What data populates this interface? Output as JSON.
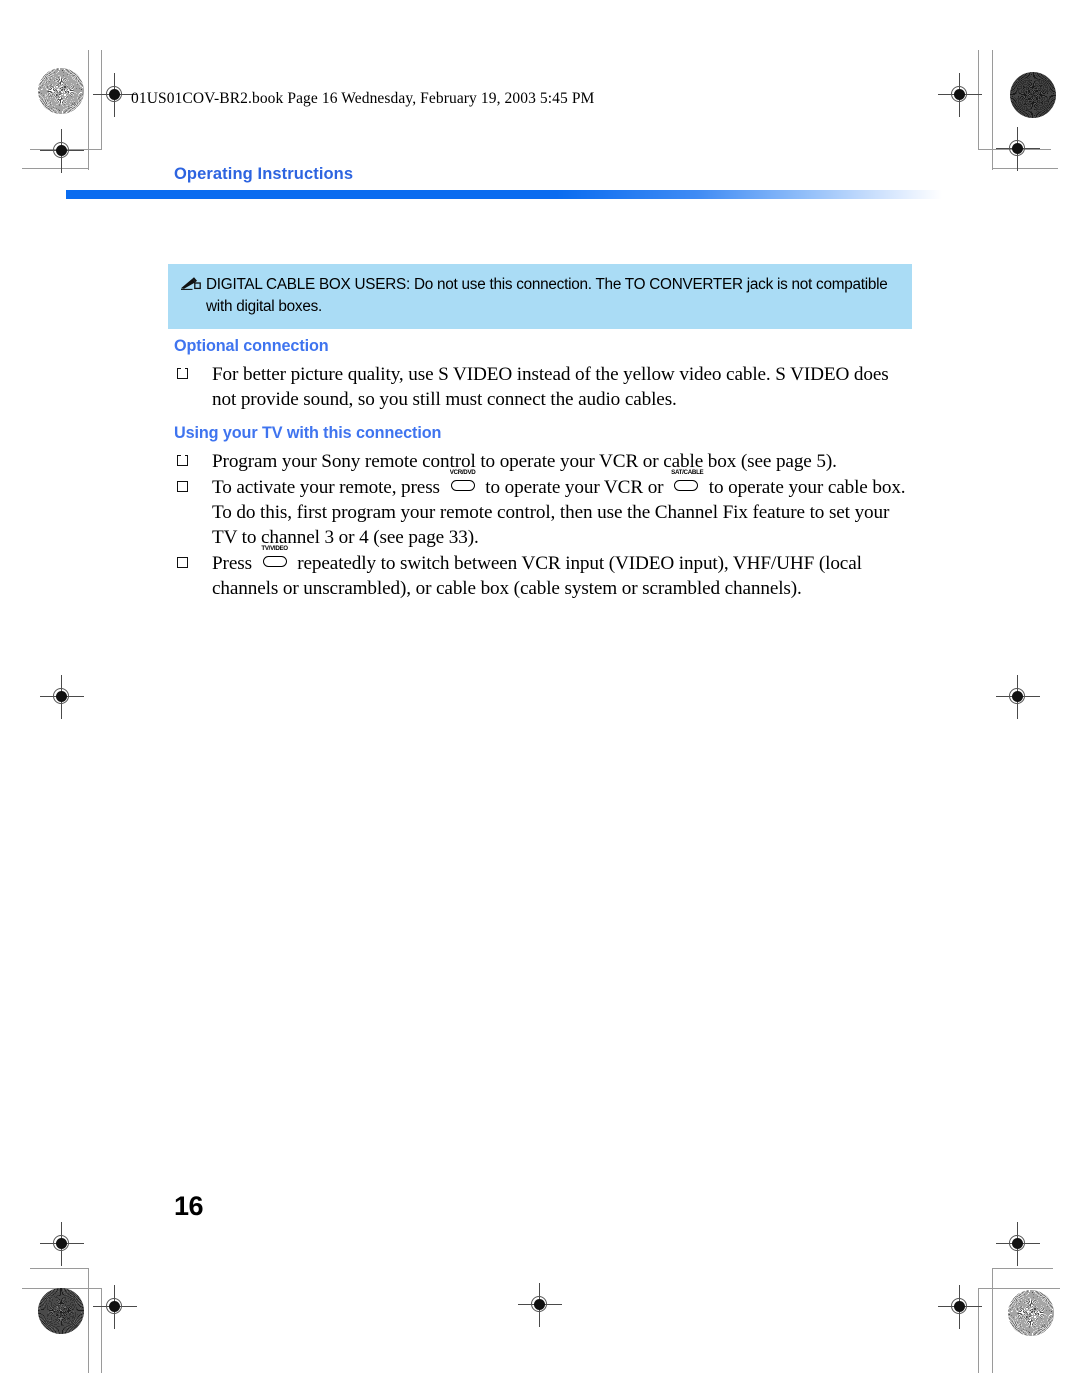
{
  "document": {
    "filename_line": "01US01COV-BR2.book  Page 16  Wednesday, February 19, 2003  5:45 PM",
    "running_head": "Operating Instructions",
    "page_number": "16",
    "accent_color": "#2d64e0",
    "heading_color": "#3f74ef",
    "note_background": "#aadcf5",
    "rule_color": "#0a6cf0"
  },
  "note": {
    "icon": "pencil-note-icon",
    "text": "DIGITAL CABLE BOX USERS: Do not use this connection. The TO CONVERTER jack is not compatible with digital boxes."
  },
  "sections": [
    {
      "id": "optional-connection",
      "heading": "Optional connection",
      "bullets": [
        {
          "parts": [
            {
              "type": "text",
              "value": "For better picture quality, use S VIDEO instead of the yellow video cable. S VIDEO does not provide sound, so you still must connect the audio cables."
            }
          ]
        }
      ]
    },
    {
      "id": "using-your-tv",
      "heading": "Using your TV with this connection",
      "bullets": [
        {
          "parts": [
            {
              "type": "text",
              "value": "Program your Sony remote control to operate your VCR or cable box (see page 5)."
            }
          ]
        },
        {
          "parts": [
            {
              "type": "text",
              "value": "To activate your remote, press "
            },
            {
              "type": "button",
              "value": "VCR/DVD"
            },
            {
              "type": "text",
              "value": " to operate your VCR or "
            },
            {
              "type": "button",
              "value": "SAT/CABLE"
            },
            {
              "type": "text",
              "value": " to operate your cable box. To do this, first program your remote control, then use the Channel Fix feature to set your TV to channel 3 or 4 (see page 33)."
            }
          ]
        },
        {
          "parts": [
            {
              "type": "text",
              "value": "Press "
            },
            {
              "type": "button",
              "value": "TV/VIDEO"
            },
            {
              "type": "text",
              "value": " repeatedly to switch between VCR input (VIDEO input), VHF/UHF  (local channels or unscrambled), or cable box (cable system or scrambled channels)."
            }
          ]
        }
      ]
    }
  ]
}
